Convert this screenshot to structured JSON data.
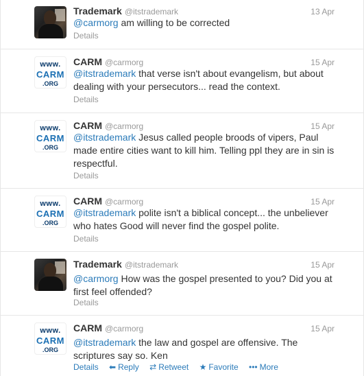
{
  "tweets": [
    {
      "name": "Trademark",
      "handle": "@itstrademark",
      "date": "13 Apr",
      "mention": "@carmorg",
      "text": " am willing to be corrected",
      "details": "Details",
      "avatar": "photo"
    },
    {
      "name": "CARM",
      "handle": "@carmorg",
      "date": "15 Apr",
      "mention": "@itstrademark",
      "text": " that verse isn't about evangelism, but about dealing with your persecutors... read the context.",
      "details": "Details",
      "avatar": "logo"
    },
    {
      "name": "CARM",
      "handle": "@carmorg",
      "date": "15 Apr",
      "mention": "@itstrademark",
      "text": " Jesus called people broods of vipers, Paul made entire cities want to kill him. Telling ppl they are in sin is respectful.",
      "details": "Details",
      "avatar": "logo"
    },
    {
      "name": "CARM",
      "handle": "@carmorg",
      "date": "15 Apr",
      "mention": "@itstrademark",
      "text": " polite isn't a biblical concept... the unbeliever who hates Good will never find the gospel polite.",
      "details": "Details",
      "avatar": "logo"
    },
    {
      "name": "Trademark",
      "handle": "@itstrademark",
      "date": "15 Apr",
      "mention": "@carmorg",
      "text": " How was the gospel presented to you? Did you at first feel offended?",
      "details": "Details",
      "avatar": "photo"
    },
    {
      "name": "CARM",
      "handle": "@carmorg",
      "date": "15 Apr",
      "mention": "@itstrademark",
      "text": " the law and gospel are offensive. The scriptures say so. Ken",
      "details": "Details",
      "avatar": "logo"
    }
  ],
  "logo": {
    "line1": "www.",
    "line2": "CARM",
    "line3": ".ORG"
  },
  "actions": {
    "details": "Details",
    "reply": "Reply",
    "retweet": "Retweet",
    "favorite": "Favorite",
    "more": "More",
    "reply_icon": "reply-icon",
    "retweet_icon": "retweet-icon",
    "favorite_icon": "star-icon",
    "more_icon": "ellipsis-icon"
  },
  "colors": {
    "link": "#2b7bb9",
    "muted": "#999999",
    "text": "#333333"
  }
}
